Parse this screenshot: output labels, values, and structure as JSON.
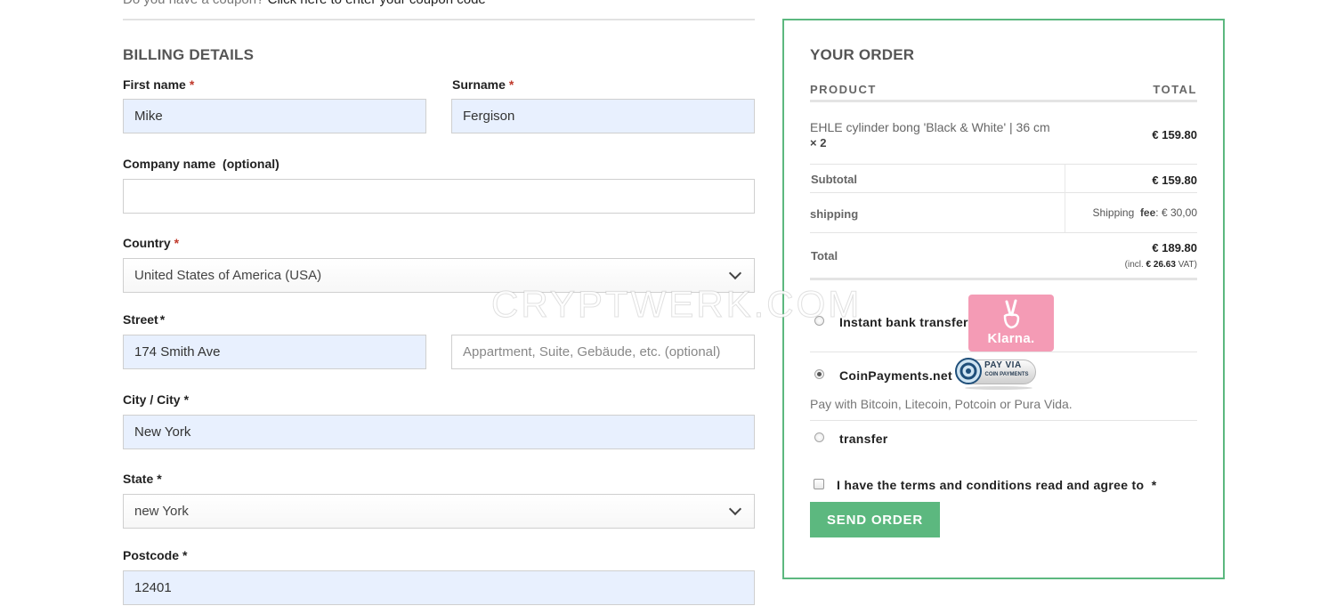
{
  "coupon": {
    "question": "Do you have a coupon?",
    "link": "Click here to enter your coupon code"
  },
  "billing": {
    "title": "BILLING DETAILS",
    "required_mark": "*",
    "first_name": {
      "label": "First name",
      "value": "Mike"
    },
    "surname": {
      "label": "Surname",
      "value": "Fergison"
    },
    "company": {
      "label": "Company name",
      "optional": "(optional)",
      "value": ""
    },
    "country": {
      "label": "Country",
      "value": "United States of America (USA)"
    },
    "street": {
      "label": "Street",
      "value": "174 Smith Ave",
      "placeholder2": "Appartment, Suite, Gebäude, etc. (optional)"
    },
    "city": {
      "label": "City / City",
      "value": "New York"
    },
    "state": {
      "label": "State",
      "value": "new York"
    },
    "postcode": {
      "label": "Postcode",
      "value": "12401"
    }
  },
  "order": {
    "title": "YOUR ORDER",
    "col_product": "PRODUCT",
    "col_total": "TOTAL",
    "item": {
      "name": "EHLE cylinder bong 'Black & White' | 36 cm",
      "qty": "× 2",
      "total": "€ 159.80"
    },
    "subtotal": {
      "label": "Subtotal",
      "value": "€ 159.80"
    },
    "shipping": {
      "label": "shipping",
      "method": "Shipping",
      "fee_label": "fee",
      "fee_value": ": € 30,00"
    },
    "total": {
      "label": "Total",
      "value": "€ 189.80",
      "vat_prefix": "(incl.",
      "vat_amount": "€ 26.63",
      "vat_suffix": "VAT)"
    }
  },
  "payment": {
    "selected": "coinpayments",
    "methods": [
      {
        "id": "klarna",
        "label": "Instant bank transfer",
        "badge": "Klarna."
      },
      {
        "id": "coinpayments",
        "label": "CoinPayments.net",
        "badge_line1": "PAY VIA",
        "badge_line2": "COIN PAYMENTS",
        "description": "Pay with Bitcoin, Litecoin, Potcoin or Pura Vida."
      },
      {
        "id": "transfer",
        "label": "transfer"
      }
    ]
  },
  "terms": {
    "label": "I have the terms and conditions read and agree to",
    "required_mark": "*"
  },
  "send_button": "SEND ORDER",
  "watermark": "CRYPTWERK.COM",
  "colors": {
    "accent": "#5cb87f",
    "autofill": "#e8f0fe",
    "klarna": "#f49bb5",
    "required": "#c0392b"
  }
}
